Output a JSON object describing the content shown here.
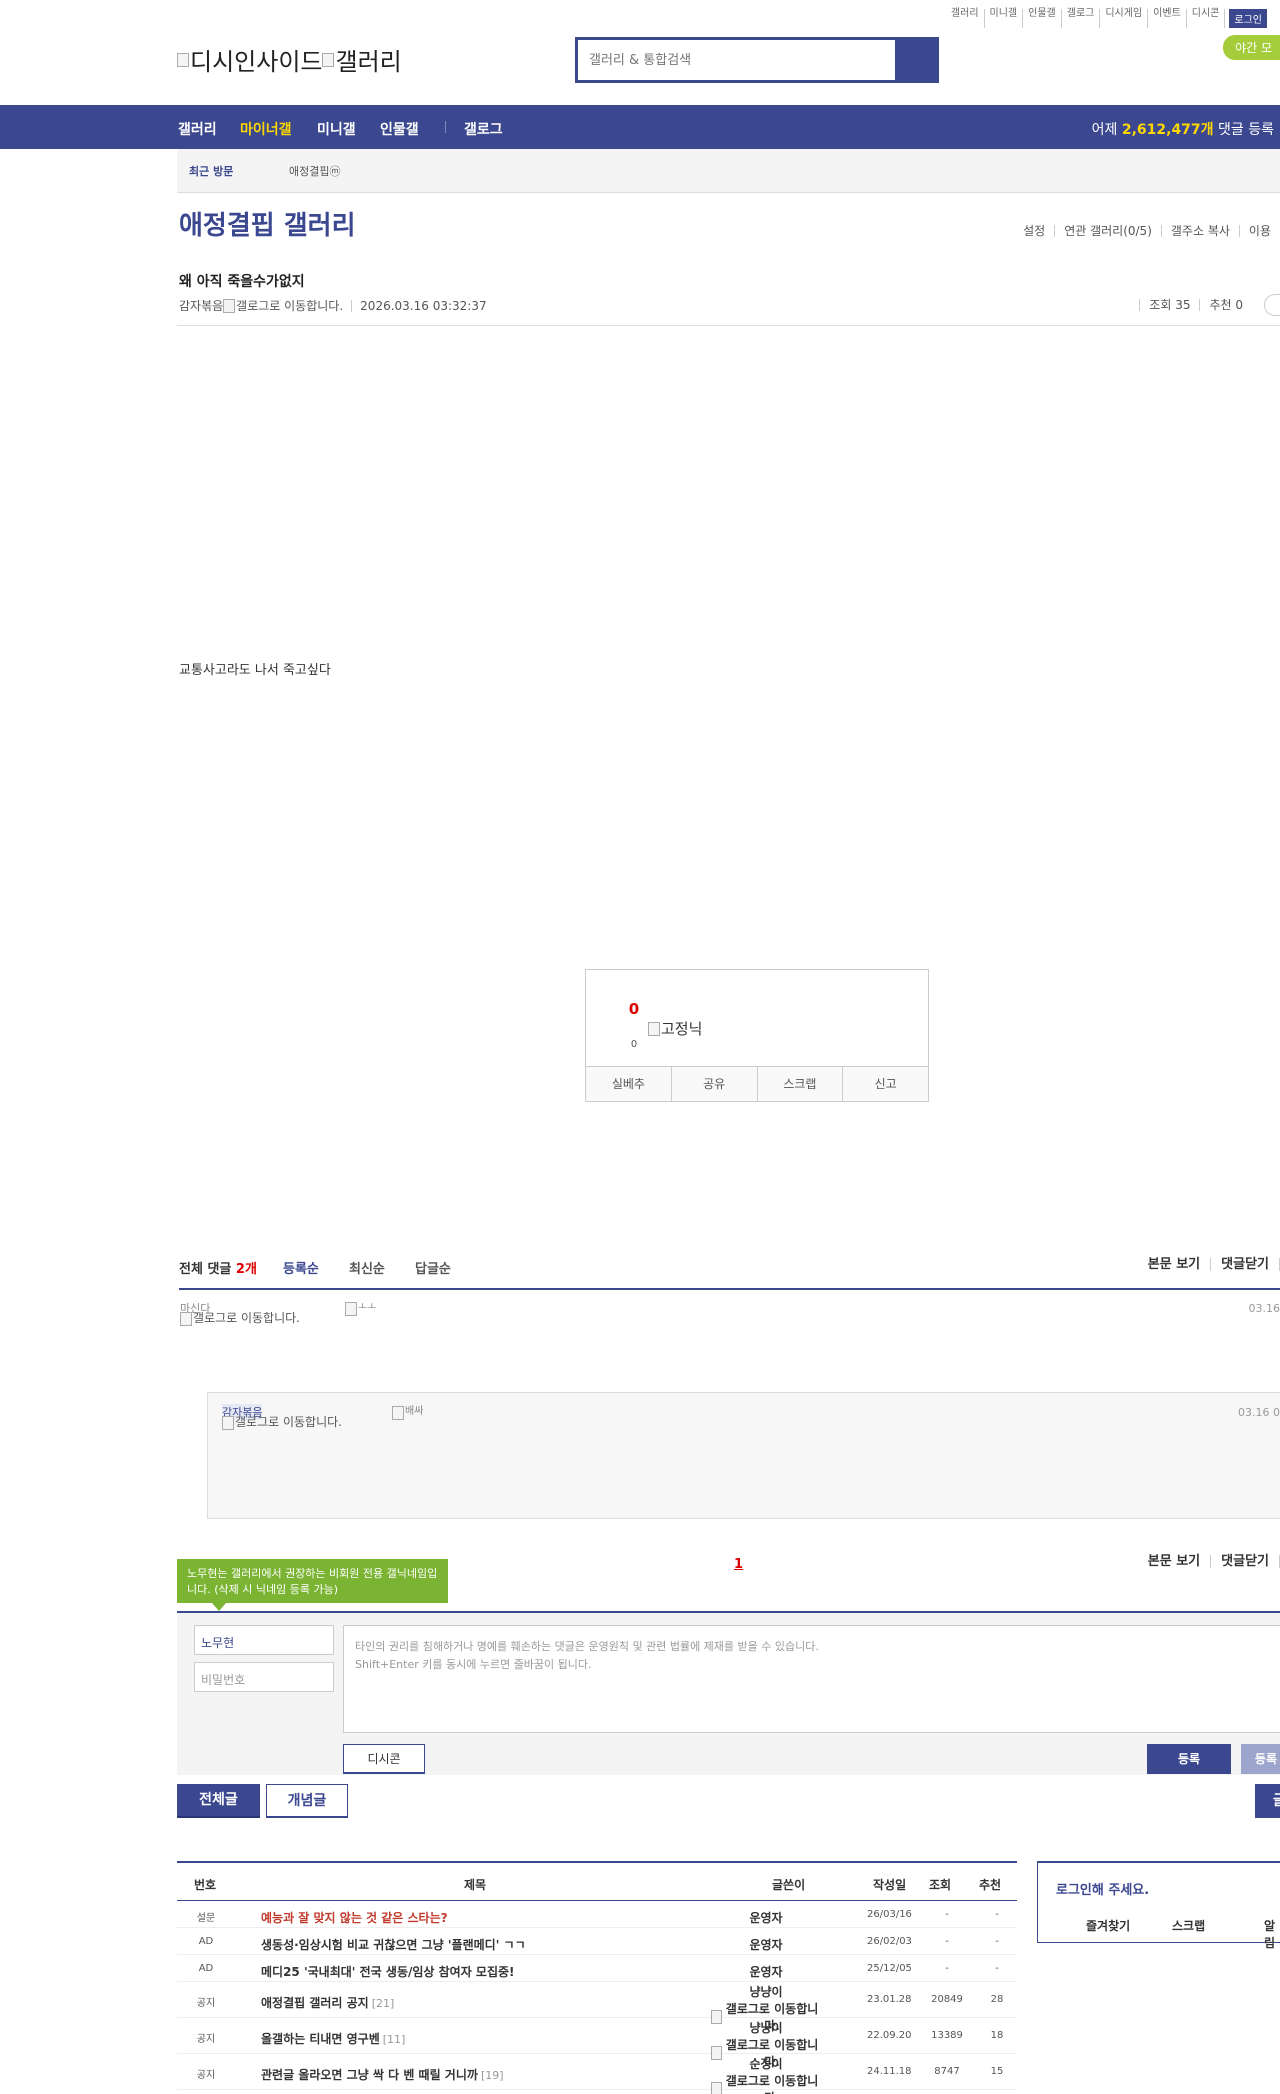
{
  "top_links": [
    "갤러리",
    "미니갤",
    "인물갤",
    "갤로그",
    "디시게임",
    "이벤트",
    "디시콘"
  ],
  "login_label": "로그인",
  "night_label": "야간 모",
  "logo_text": "디시인사이드",
  "logo_sub": "갤러리",
  "search_placeholder": "갤러리 & 통합검색",
  "nav": {
    "items": [
      "갤러리",
      "마이너갤",
      "미니갤",
      "인물갤",
      "갤로그"
    ],
    "stat_prefix": "어제",
    "stat_value": "2,612,477개",
    "stat_suffix": "댓글 등록"
  },
  "subnav": {
    "recent": "최근 방문",
    "gallery": "애정결핍",
    "badge": "ⓜ"
  },
  "gallery_title": "애정결핍 갤러리",
  "gallery_tools": [
    "설정",
    "연관 갤러리(0/5)",
    "갤주소 복사",
    "이용"
  ],
  "post": {
    "title": "왜 아직 죽을수가없지",
    "author": "감자볶음",
    "gallog_alt": "갤로그로 이동합니다.",
    "datetime": "2026.03.16 03:32:37",
    "views_label": "조회 35",
    "rec_label": "추천 0",
    "body": "교통사고라도 나서 죽고싶다"
  },
  "recommend": {
    "count": "0",
    "fixed_nick": "고정닉",
    "fixed_count": "0",
    "buttons": [
      "실베추",
      "공유",
      "스크랩",
      "신고"
    ]
  },
  "comments": {
    "total_label": "전체 댓글",
    "total_count": "2개",
    "sorts": [
      "등록순",
      "최신순",
      "답글순"
    ],
    "right_links": [
      "본문 보기",
      "댓글닫기"
    ],
    "items": [
      {
        "nick": "마신다",
        "gallog": "갤로그로 이동합니다.",
        "content_alt": "ㅗㅗ",
        "date": "03.16"
      },
      {
        "nick": "감자볶음",
        "gallog": "갤로그로 이동합니다.",
        "content_alt": "배싸",
        "date": "03.16 0"
      }
    ],
    "page": "1"
  },
  "write": {
    "tooltip": "노무현는 갤러리에서 권장하는 비회원 전용 갤닉네임입니다. (삭제 시 닉네임 등록 가능)",
    "nick_value": "노무현",
    "pw_placeholder": "비밀번호",
    "notice_line1": "타인의 권리를 침해하거나 명예를 훼손하는 댓글은 운영원칙 및 관련 법률에 제재를 받을 수 있습니다.",
    "notice_line2": "Shift+Enter 키를 동시에 누르면 줄바꿈이 됩니다.",
    "dccon": "디시콘",
    "submit": "등록",
    "submit2": "등록"
  },
  "list": {
    "tabs": [
      "전체글",
      "개념글"
    ],
    "write_label": "글",
    "headers": [
      "번호",
      "제목",
      "글쓴이",
      "작성일",
      "조회",
      "추천"
    ],
    "rows": [
      {
        "num": "설문",
        "title": "예능과 잘 맞지 않는 것 같은 스타는?",
        "reply": "",
        "writer": "운영자",
        "date": "26/03/16",
        "views": "-",
        "rec": "-",
        "red": true
      },
      {
        "num": "AD",
        "title": "생동성·임상시험 비교 귀찮으면 그냥 '플랜메디' ㄱㄱ",
        "reply": "",
        "writer": "운영자",
        "date": "26/02/03",
        "views": "-",
        "rec": "-",
        "red": false
      },
      {
        "num": "AD",
        "title": "메디25 '국내최대' 전국 생동/임상 참여자 모집중!",
        "reply": "",
        "writer": "운영자",
        "date": "25/12/05",
        "views": "-",
        "rec": "-",
        "red": false
      },
      {
        "num": "공지",
        "title": "애정결핍 갤러리 공지",
        "reply": "[21]",
        "writer": "냥냥이",
        "gallog": "갤로그로 이동합니다.",
        "date": "23.01.28",
        "views": "20849",
        "rec": "28",
        "red": false
      },
      {
        "num": "공지",
        "title": "올갤하는 티내면 영구벤",
        "reply": "[11]",
        "writer": "냥냥이",
        "gallog": "갤로그로 이동합니다.",
        "date": "22.09.20",
        "views": "13389",
        "rec": "18",
        "red": false
      },
      {
        "num": "공지",
        "title": "관련글 올라오면 그냥 싹 다 벤 때릴 거니까",
        "reply": "[19]",
        "writer": "순정이",
        "gallog": "갤로그로 이동합니다.",
        "date": "24.11.18",
        "views": "8747",
        "rec": "15",
        "red": false
      }
    ]
  },
  "login_box": {
    "title": "로그인해 주세요.",
    "links": [
      "즐겨찾기",
      "스크랩",
      "알림"
    ]
  }
}
